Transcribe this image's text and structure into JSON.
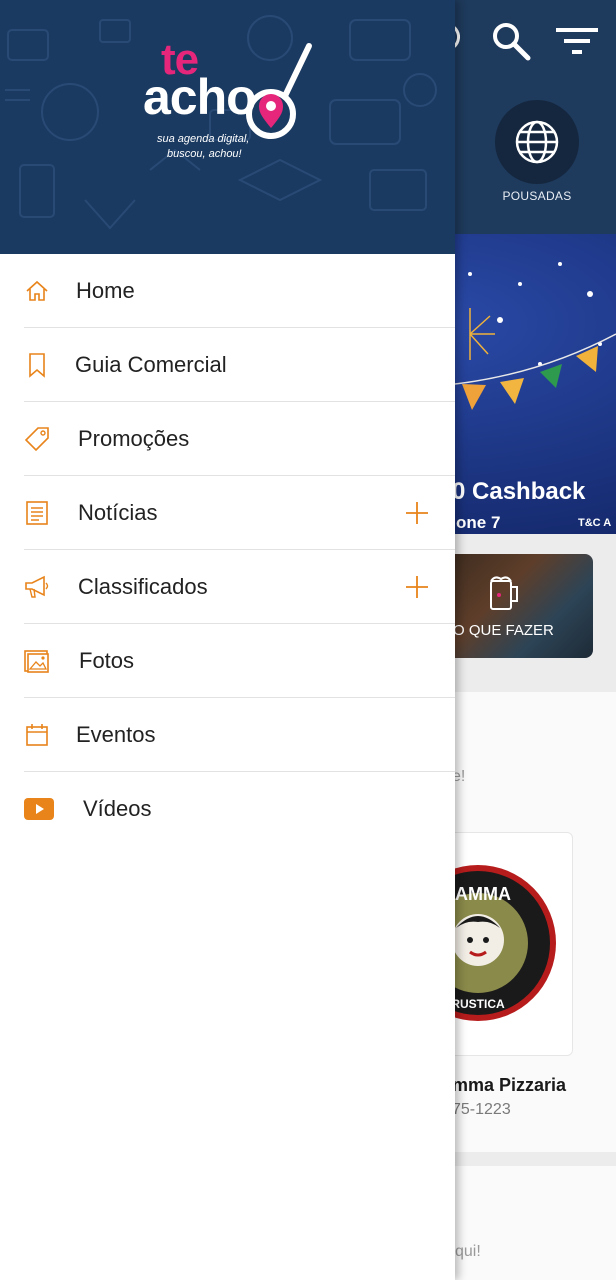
{
  "brand": {
    "name_part1": "te",
    "name_part2": "acho",
    "tagline_line1": "sua agenda digital,",
    "tagline_line2": "buscou, achou!",
    "pink": "#e6267b",
    "header_bg": "#1b3a61"
  },
  "menu": {
    "accent_color": "#e8841a",
    "items": [
      {
        "label": "Home",
        "icon": "home-icon",
        "expandable": false
      },
      {
        "label": "Guia Comercial",
        "icon": "bookmark-icon",
        "expandable": false
      },
      {
        "label": "Promoções",
        "icon": "tag-icon",
        "expandable": false
      },
      {
        "label": "Notícias",
        "icon": "newspaper-icon",
        "expandable": true
      },
      {
        "label": "Classificados",
        "icon": "megaphone-icon",
        "expandable": true
      },
      {
        "label": "Fotos",
        "icon": "photos-icon",
        "expandable": false
      },
      {
        "label": "Eventos",
        "icon": "calendar-icon",
        "expandable": false
      },
      {
        "label": "Vídeos",
        "icon": "play-video-icon",
        "expandable": false
      }
    ]
  },
  "background": {
    "category_label": "POUSADAS",
    "banner_title": "0 Cashback",
    "banner_sub": "one 7",
    "banner_tc": "T&C A",
    "tile_label": "O QUE FAZER",
    "hint_1": "e!",
    "hint_2": "qui!",
    "card_name": "mma Pizzaria",
    "card_phone": "75-1223",
    "logo_text_top": "JAMMA",
    "logo_text_bottom": "RUSTICA"
  }
}
